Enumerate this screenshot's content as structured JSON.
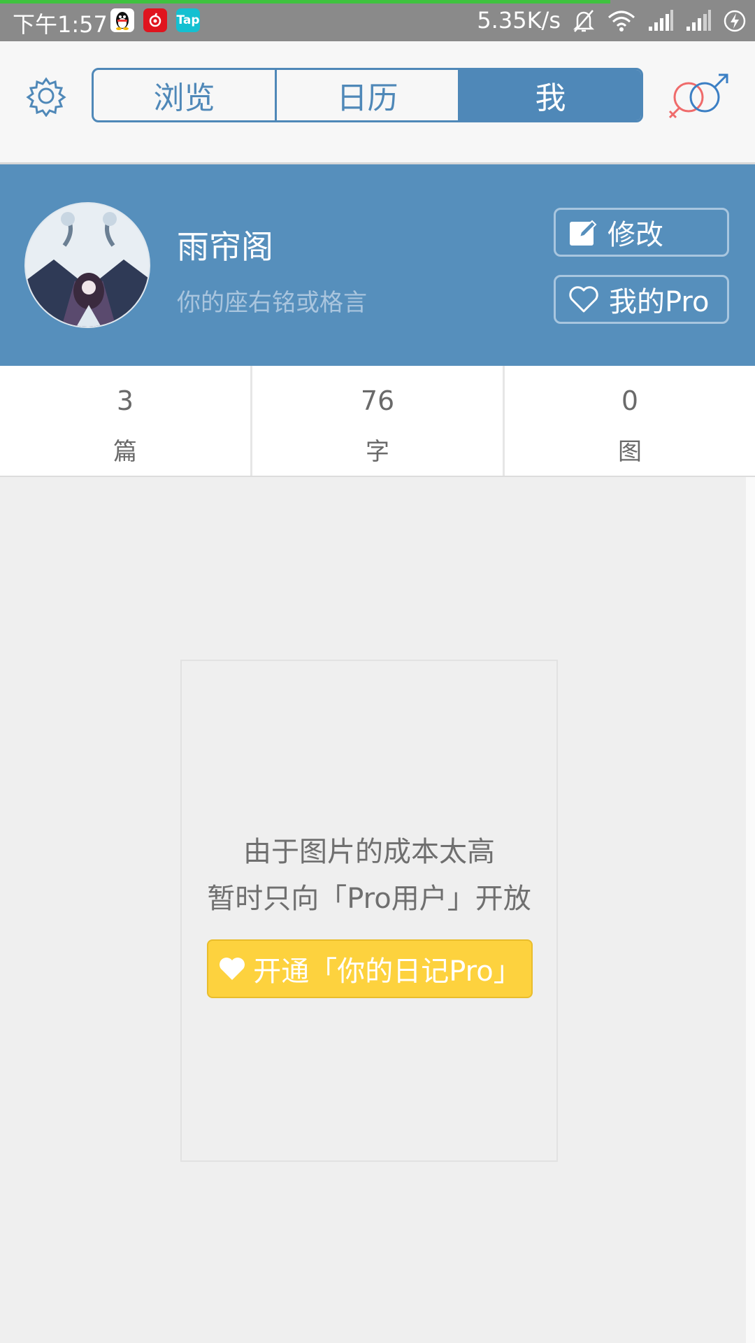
{
  "status_bar": {
    "time": "下午1:57",
    "apps": [
      {
        "name": "qq-icon",
        "label": ""
      },
      {
        "name": "netease-music-icon",
        "label": ""
      },
      {
        "name": "taptap-icon",
        "label": "Tap"
      }
    ],
    "net_speed": "5.35K/s",
    "icons": [
      "mute-bell-icon",
      "wifi-icon",
      "signal-icon",
      "signal-icon",
      "charging-icon"
    ]
  },
  "header": {
    "tabs": [
      {
        "label": "浏览",
        "active": false
      },
      {
        "label": "日历",
        "active": false
      },
      {
        "label": "我",
        "active": true
      }
    ]
  },
  "profile": {
    "name": "雨帘阁",
    "motto": "你的座右铭或格言",
    "edit_label": "修改",
    "pro_label": "我的Pro"
  },
  "stats": [
    {
      "value": "3",
      "label": "篇"
    },
    {
      "value": "76",
      "label": "字"
    },
    {
      "value": "0",
      "label": "图"
    }
  ],
  "notice": {
    "line1": "由于图片的成本太高",
    "line2": "暂时只向「Pro用户」开放",
    "button_label": "开通「你的日记Pro」"
  },
  "colors": {
    "primary": "#568fbc",
    "tab_blue": "#4f88b8",
    "pro_yellow": "#fdd23e",
    "male": "#3b7fc4",
    "female": "#ef6b6b"
  }
}
